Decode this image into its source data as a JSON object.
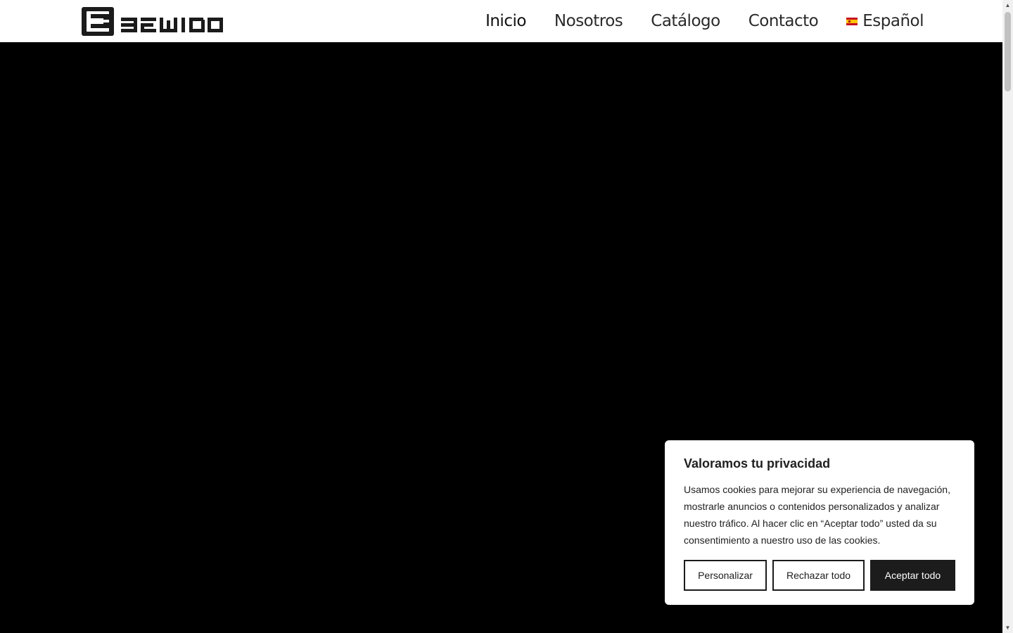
{
  "header": {
    "logo_text": "BEWIDO",
    "nav": [
      {
        "label": "Inicio",
        "active": true
      },
      {
        "label": "Nosotros"
      },
      {
        "label": "Catálogo"
      },
      {
        "label": "Contacto"
      }
    ],
    "language": {
      "label": "Español",
      "flag_icon": "spain-flag-icon"
    }
  },
  "hero": {
    "background": "#000000"
  },
  "cookie_banner": {
    "title": "Valoramos tu privacidad",
    "text": "Usamos cookies para mejorar su experiencia de navegación, mostrarle anuncios o contenidos personalizados y analizar nuestro tráfico. Al hacer clic en “Aceptar todo” usted da su consentimiento a nuestro uso de las cookies.",
    "buttons": {
      "customize": "Personalizar",
      "reject": "Rechazar todo",
      "accept": "Aceptar todo"
    },
    "accent": "#1c1c1c"
  }
}
